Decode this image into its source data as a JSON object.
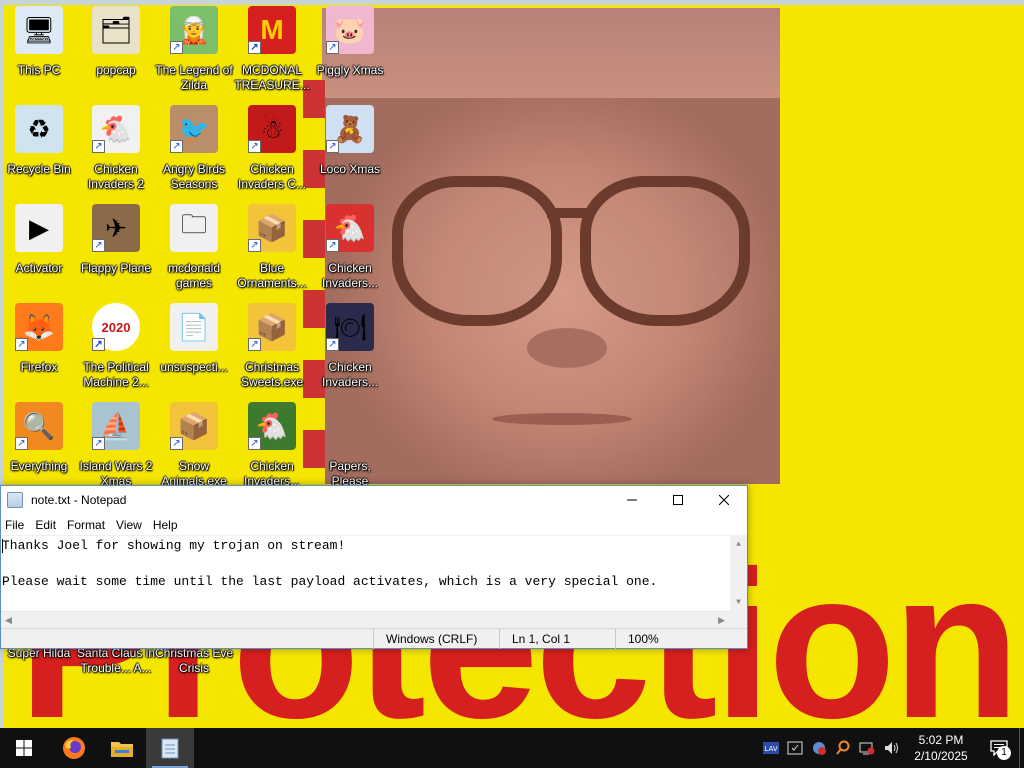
{
  "desktop": {
    "icons": [
      {
        "label": "This PC",
        "icon": "computer-icon",
        "glyph": "🖥",
        "bg": "#dde9f5",
        "shortcut": false
      },
      {
        "label": "popcap",
        "icon": "folder-popcap-icon",
        "glyph": "🗂",
        "bg": "#e9e2c8",
        "shortcut": false
      },
      {
        "label": "The Legend of Zilda",
        "icon": "game-zilda-icon",
        "glyph": "🧝",
        "bg": "#7bbf6a",
        "shortcut": true
      },
      {
        "label": "MCDONAL TREASURE...",
        "icon": "mcdonald-icon",
        "glyph": "M",
        "bg": "#d62020",
        "shortcut": true
      },
      {
        "label": "Piggly Xmas",
        "icon": "pig-icon",
        "glyph": "🐷",
        "bg": "#f0b8d0",
        "shortcut": true
      },
      {
        "label": "Recycle Bin",
        "icon": "recycle-bin-icon",
        "glyph": "♻",
        "bg": "#cfe4ee",
        "shortcut": false
      },
      {
        "label": "Chicken Invaders 2",
        "icon": "chicken-icon",
        "glyph": "🐔",
        "bg": "#f1f1f1",
        "shortcut": true
      },
      {
        "label": "Angry Birds Seasons",
        "icon": "angry-birds-icon",
        "glyph": "🐦",
        "bg": "#b98f6a",
        "shortcut": true
      },
      {
        "label": "Chicken Invaders C...",
        "icon": "chicken-snowman-icon",
        "glyph": "☃",
        "bg": "#c21a1a",
        "shortcut": true
      },
      {
        "label": "Loco Xmas",
        "icon": "teddy-bear-icon",
        "glyph": "🧸",
        "bg": "#cfe0f2",
        "shortcut": true
      },
      {
        "label": "Activator",
        "icon": "file-icon",
        "glyph": "▶",
        "bg": "#f0f0f0",
        "shortcut": false
      },
      {
        "label": "Flappy Plane",
        "icon": "flappy-plane-icon",
        "glyph": "✈",
        "bg": "#8b6a4a",
        "shortcut": true
      },
      {
        "label": "mcdonald games",
        "icon": "folder-icon",
        "glyph": "🗀",
        "bg": "#f0f0f0",
        "shortcut": false
      },
      {
        "label": "Blue Ornaments...",
        "icon": "installer-icon",
        "glyph": "📦",
        "bg": "#f3c43a",
        "shortcut": true
      },
      {
        "label": "Chicken Invaders...",
        "icon": "chicken-xmas-icon",
        "glyph": "🐔",
        "bg": "#d93030",
        "shortcut": true
      },
      {
        "label": "Firefox",
        "icon": "firefox-icon",
        "glyph": "🦊",
        "bg": "#ff7a1a",
        "shortcut": true
      },
      {
        "label": "The Political Machine 2...",
        "icon": "political-machine-icon",
        "glyph": "2020",
        "bg": "#ffffff",
        "shortcut": true
      },
      {
        "label": "unsuspecti...",
        "icon": "file-icon",
        "glyph": "📄",
        "bg": "#f0f0f0",
        "shortcut": false
      },
      {
        "label": "Christmas Sweets.exe",
        "icon": "installer-icon",
        "glyph": "📦",
        "bg": "#f3c43a",
        "shortcut": true
      },
      {
        "label": "Chicken Invaders...",
        "icon": "chicken-plates-icon",
        "glyph": "🍽",
        "bg": "#2a2a4a",
        "shortcut": true
      },
      {
        "label": "Everything",
        "icon": "magnifier-icon",
        "glyph": "🔍",
        "bg": "#f08a20",
        "shortcut": true
      },
      {
        "label": "Island Wars 2 Xmas",
        "icon": "island-wars-icon",
        "glyph": "⛵",
        "bg": "#a9c3d0",
        "shortcut": true
      },
      {
        "label": "Snow Animals.exe",
        "icon": "installer-icon",
        "glyph": "📦",
        "bg": "#f3c43a",
        "shortcut": true
      },
      {
        "label": "Chicken Invaders...",
        "icon": "chicken-pirate-icon",
        "glyph": "🐔",
        "bg": "#3d7a2e",
        "shortcut": true
      },
      {
        "label": "Papers, Please",
        "icon": "papers-please-icon",
        "glyph": "",
        "bg": "transparent",
        "shortcut": false
      },
      {
        "label": "Super Hilda",
        "icon": "super-hilda-icon",
        "glyph": "",
        "bg": "transparent",
        "shortcut": false
      },
      {
        "label": "Santa Claus in Trouble... A...",
        "icon": "santa-icon",
        "glyph": "",
        "bg": "transparent",
        "shortcut": false
      },
      {
        "label": "Christmas Eve Crisis",
        "icon": "christmas-eve-icon",
        "glyph": "",
        "bg": "transparent",
        "shortcut": false
      }
    ]
  },
  "wallpaper": {
    "big_text": "Protection"
  },
  "notepad": {
    "title": "note.txt - Notepad",
    "menu": [
      "File",
      "Edit",
      "Format",
      "View",
      "Help"
    ],
    "content": "Thanks Joel for showing my trojan on stream!\n\nPlease wait some time until the last payload activates, which is a very special one.",
    "status": {
      "encoding": "Windows (CRLF)",
      "position": "Ln 1, Col 1",
      "zoom": "100%"
    }
  },
  "taskbar": {
    "apps": [
      {
        "name": "start-button",
        "icon": "windows-logo-icon"
      },
      {
        "name": "taskbar-firefox",
        "icon": "firefox-icon"
      },
      {
        "name": "taskbar-file-explorer",
        "icon": "folder-icon"
      },
      {
        "name": "taskbar-notepad",
        "icon": "notepad-icon",
        "active": true
      }
    ],
    "tray": {
      "icons": [
        "lav-icon",
        "security-icon",
        "network-warning-icon",
        "magnifier-icon",
        "network-icon",
        "volume-icon"
      ],
      "time": "5:02 PM",
      "date": "2/10/2025",
      "notification_count": "1"
    }
  }
}
